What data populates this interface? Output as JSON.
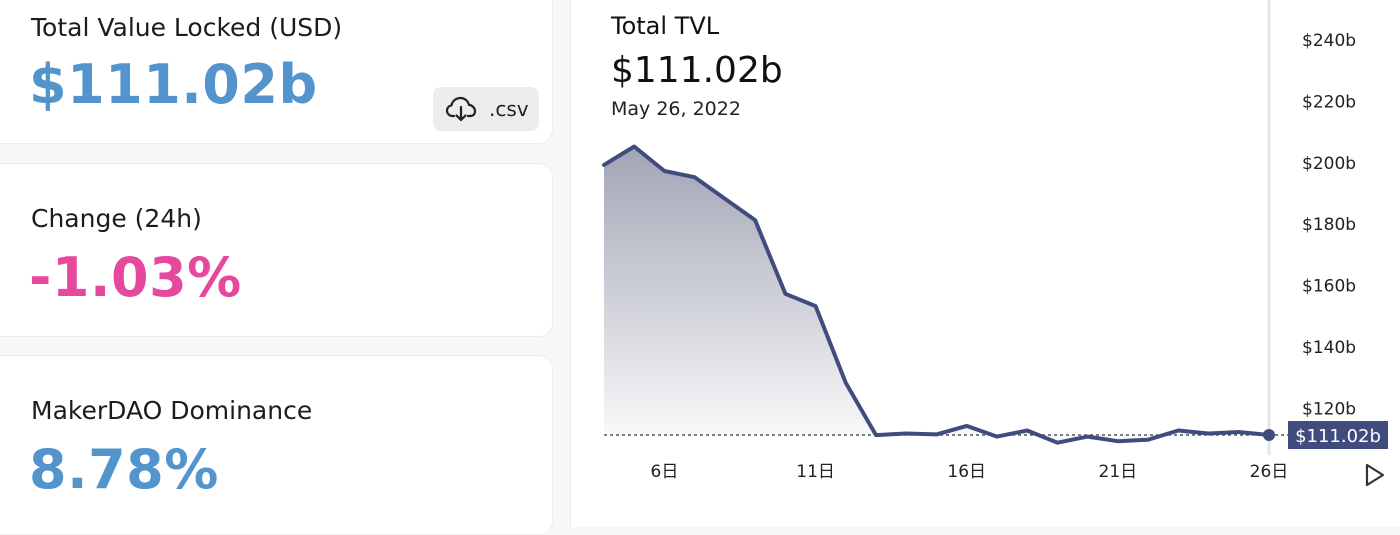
{
  "stats": {
    "tvl": {
      "label": "Total Value Locked (USD)",
      "value": "$111.02b",
      "csv_label": ".csv",
      "value_color": "#5394cc"
    },
    "change": {
      "label": "Change (24h)",
      "value": "-1.03%",
      "value_color": "#e6489b"
    },
    "dominance": {
      "label": "MakerDAO Dominance",
      "value": "8.78%",
      "value_color": "#5394cc"
    }
  },
  "chart_header": {
    "title": "Total TVL",
    "value": "$111.02b",
    "date": "May 26, 2022"
  },
  "chart_data": {
    "type": "area",
    "x": [
      4,
      5,
      6,
      7,
      8,
      9,
      10,
      11,
      12,
      13,
      14,
      15,
      16,
      17,
      18,
      19,
      20,
      21,
      22,
      23,
      24,
      25,
      26
    ],
    "x_ticks": [
      6,
      11,
      16,
      21,
      26
    ],
    "x_tick_labels": [
      "6日",
      "11日",
      "16日",
      "21日",
      "26日"
    ],
    "y": [
      199,
      205,
      197,
      195,
      188,
      181,
      157,
      153,
      128,
      111,
      111.5,
      111.2,
      114,
      110.5,
      112.5,
      108.5,
      110.5,
      109,
      109.5,
      112.5,
      111.5,
      112,
      111.02
    ],
    "ylim": [
      111.02,
      240
    ],
    "y_ticks": [
      120,
      140,
      160,
      180,
      200,
      220,
      240
    ],
    "y_tick_labels": [
      "$120b",
      "$140b",
      "$160b",
      "$180b",
      "$200b",
      "$220b",
      "$240b"
    ],
    "current_value_label": "$111.02b",
    "reference_line": 111.02,
    "line_color": "#414c7e",
    "fill_color": "#9c9fb0",
    "title": "",
    "xlabel": "",
    "ylabel": ""
  },
  "icons": {
    "download": "cloud-download-icon",
    "play": "play-icon"
  }
}
